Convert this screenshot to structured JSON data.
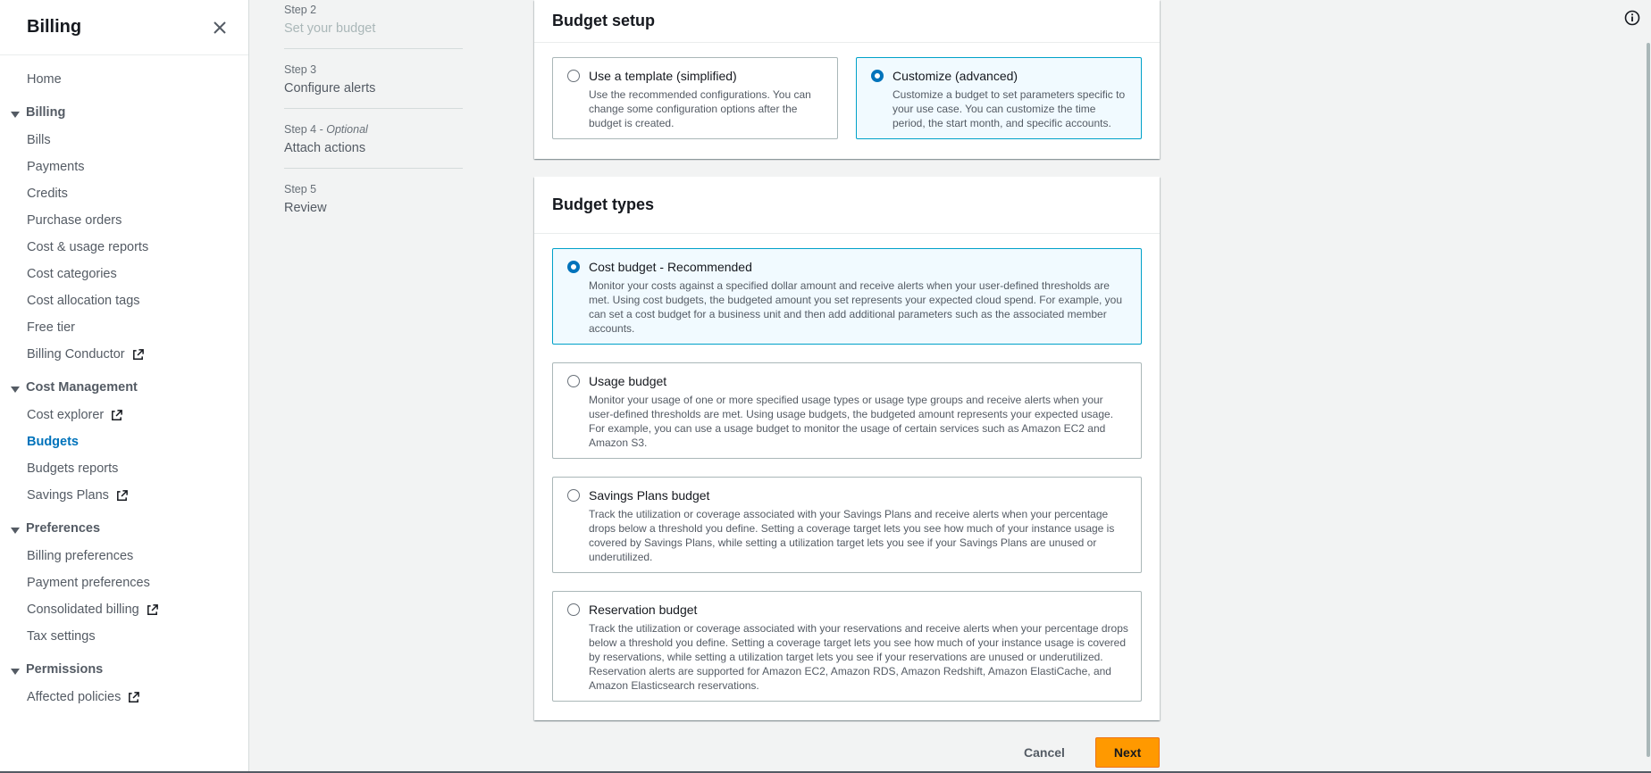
{
  "sidebar": {
    "title": "Billing",
    "home": "Home",
    "sections": [
      {
        "label": "Billing",
        "items": [
          {
            "label": "Bills",
            "external": false
          },
          {
            "label": "Payments",
            "external": false
          },
          {
            "label": "Credits",
            "external": false
          },
          {
            "label": "Purchase orders",
            "external": false
          },
          {
            "label": "Cost & usage reports",
            "external": false
          },
          {
            "label": "Cost categories",
            "external": false
          },
          {
            "label": "Cost allocation tags",
            "external": false
          },
          {
            "label": "Free tier",
            "external": false
          },
          {
            "label": "Billing Conductor",
            "external": true
          }
        ]
      },
      {
        "label": "Cost Management",
        "items": [
          {
            "label": "Cost explorer",
            "external": true
          },
          {
            "label": "Budgets",
            "external": false,
            "active": true
          },
          {
            "label": "Budgets reports",
            "external": false
          },
          {
            "label": "Savings Plans",
            "external": true
          }
        ]
      },
      {
        "label": "Preferences",
        "items": [
          {
            "label": "Billing preferences",
            "external": false
          },
          {
            "label": "Payment preferences",
            "external": false
          },
          {
            "label": "Consolidated billing",
            "external": true
          },
          {
            "label": "Tax settings",
            "external": false
          }
        ]
      },
      {
        "label": "Permissions",
        "items": [
          {
            "label": "Affected policies",
            "external": true
          }
        ]
      }
    ]
  },
  "steps": [
    {
      "number": "Step 2",
      "optional": "",
      "name": "Set your budget",
      "disabled": true
    },
    {
      "number": "Step 3",
      "optional": "",
      "name": "Configure alerts",
      "disabled": false
    },
    {
      "number": "Step 4 - ",
      "optional": "Optional",
      "name": "Attach actions",
      "disabled": false
    },
    {
      "number": "Step 5",
      "optional": "",
      "name": "Review",
      "disabled": false
    }
  ],
  "budget_setup": {
    "heading": "Budget setup",
    "options": [
      {
        "title": "Use a template (simplified)",
        "description": "Use the recommended configurations. You can change some configuration options after the budget is created.",
        "selected": false
      },
      {
        "title": "Customize (advanced)",
        "description": "Customize a budget to set parameters specific to your use case. You can customize the time period, the start month, and specific accounts.",
        "selected": true
      }
    ]
  },
  "budget_types": {
    "heading": "Budget types",
    "options": [
      {
        "title": "Cost budget - Recommended",
        "description": "Monitor your costs against a specified dollar amount and receive alerts when your user-defined thresholds are met. Using cost budgets, the budgeted amount you set represents your expected cloud spend. For example, you can set a cost budget for a business unit and then add additional parameters such as the associated member accounts.",
        "selected": true
      },
      {
        "title": "Usage budget",
        "description": "Monitor your usage of one or more specified usage types or usage type groups and receive alerts when your user-defined thresholds are met. Using usage budgets, the budgeted amount represents your expected usage. For example, you can use a usage budget to monitor the usage of certain services such as Amazon EC2 and Amazon S3.",
        "selected": false
      },
      {
        "title": "Savings Plans budget",
        "description": "Track the utilization or coverage associated with your Savings Plans and receive alerts when your percentage drops below a threshold you define. Setting a coverage target lets you see how much of your instance usage is covered by Savings Plans, while setting a utilization target lets you see if your Savings Plans are unused or underutilized.",
        "selected": false
      },
      {
        "title": "Reservation budget",
        "description": "Track the utilization or coverage associated with your reservations and receive alerts when your percentage drops below a threshold you define. Setting a coverage target lets you see how much of your instance usage is covered by reservations, while setting a utilization target lets you see if your reservations are unused or underutilized. Reservation alerts are supported for Amazon EC2, Amazon RDS, Amazon Redshift, Amazon ElastiCache, and Amazon Elasticsearch reservations.",
        "selected": false
      }
    ]
  },
  "footer": {
    "cancel_label": "Cancel",
    "next_label": "Next"
  },
  "colors": {
    "accent": "#0073bb",
    "primary_button": "#ff9900",
    "selected_tile_bg": "#f1faff",
    "selected_tile_border": "#00a1c9"
  },
  "icons": {
    "close": "close-icon",
    "caret": "caret-down-icon",
    "external": "external-link-icon",
    "info": "info-icon"
  }
}
